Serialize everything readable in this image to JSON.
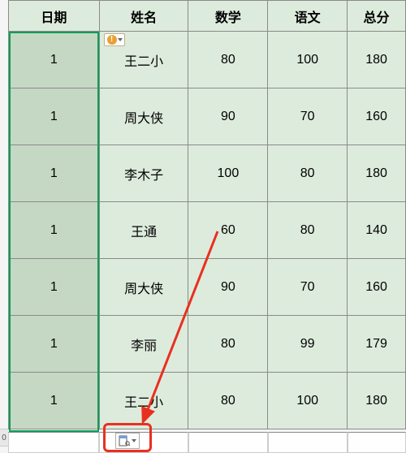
{
  "headers": {
    "date": "日期",
    "name": "姓名",
    "math": "数学",
    "chinese": "语文",
    "total": "总分"
  },
  "rows": [
    {
      "date": "1",
      "name": "王二小",
      "math": "80",
      "chinese": "100",
      "total": "180"
    },
    {
      "date": "1",
      "name": "周大侠",
      "math": "90",
      "chinese": "70",
      "total": "160"
    },
    {
      "date": "1",
      "name": "李木子",
      "math": "100",
      "chinese": "80",
      "total": "180"
    },
    {
      "date": "1",
      "name": "王通",
      "math": "60",
      "chinese": "80",
      "total": "140"
    },
    {
      "date": "1",
      "name": "周大侠",
      "math": "90",
      "chinese": "70",
      "total": "160"
    },
    {
      "date": "1",
      "name": "李丽",
      "math": "80",
      "chinese": "99",
      "total": "179"
    },
    {
      "date": "1",
      "name": "王二小",
      "math": "80",
      "chinese": "100",
      "total": "180"
    }
  ],
  "row_stub": "0",
  "chart_data": {
    "type": "table",
    "columns": [
      "日期",
      "姓名",
      "数学",
      "语文",
      "总分"
    ],
    "data": [
      [
        "1",
        "王二小",
        80,
        100,
        180
      ],
      [
        "1",
        "周大侠",
        90,
        70,
        160
      ],
      [
        "1",
        "李木子",
        100,
        80,
        180
      ],
      [
        "1",
        "王通",
        60,
        80,
        140
      ],
      [
        "1",
        "周大侠",
        90,
        70,
        160
      ],
      [
        "1",
        "李丽",
        80,
        99,
        179
      ],
      [
        "1",
        "王二小",
        80,
        100,
        180
      ]
    ]
  }
}
